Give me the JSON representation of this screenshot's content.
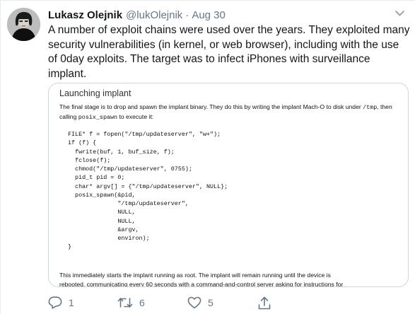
{
  "author": {
    "name": "Lukasz Olejnik",
    "handle": "@lukOlejnik",
    "date": "Aug 30"
  },
  "separator": "·",
  "tweet_text": "A number of exploit chains were used over the years. They exploited many security vulnerabilities (in kernel, or web browser), including with the use of 0day exploits. The target was to infect iPhones with surveillance implant.",
  "attachment": {
    "heading": "Launching implant",
    "para_part1": "The final stage is to drop and spawn the implant binary. They do this by writing the implant Mach-O to disk under ",
    "para_code1": "/tmp",
    "para_part2": ", then calling ",
    "para_code2": "posix_spawn",
    "para_part3": " to execute it:",
    "code_lines": [
      "FILE* f = fopen(\"/tmp/updateserver\", \"w+\");",
      "if (f) {",
      "  fwrite(buf, 1, buf_size, f);",
      "  fclose(f);",
      "  chmod(\"/tmp/updateserver\", 0755);",
      "  pid_t pid = 0;",
      "  char* argv[] = {\"/tmp/updateserver\", NULL};",
      "  posix_spawn(&pid,",
      "              \"/tmp/updateserver\",",
      "              NULL,",
      "              NULL,",
      "              &argv,",
      "              environ);",
      "}"
    ],
    "bottom_line1": "This immediately starts the implant running as root. The implant will remain running until the device is",
    "bottom_line2": "rebooted, communicating every 60 seconds with a command-and-control server asking for instructions for"
  },
  "actions": {
    "reply_count": "1",
    "retweet_count": "6",
    "like_count": "5"
  },
  "icons": {
    "reply": "reply-icon",
    "retweet": "retweet-icon",
    "like": "heart-icon",
    "share": "share-icon",
    "caret": "chevron-down-icon"
  },
  "colors": {
    "text": "#14171a",
    "secondary": "#657786",
    "border": "#ccd6dd"
  }
}
